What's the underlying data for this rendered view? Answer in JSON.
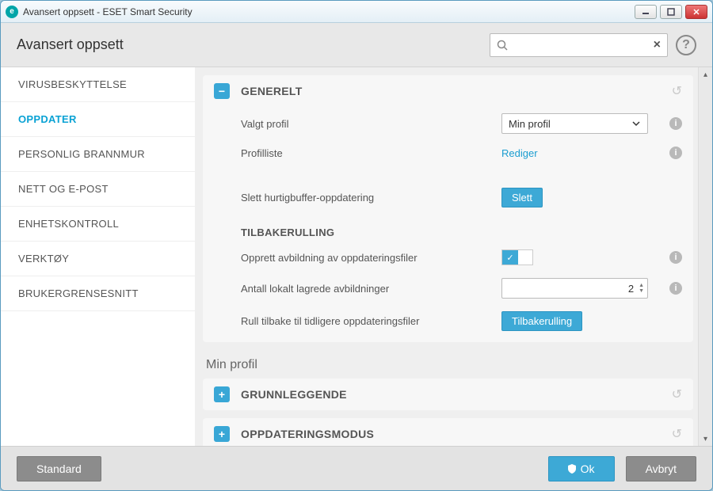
{
  "window": {
    "title": "Avansert oppsett - ESET Smart Security",
    "app_badge": "e"
  },
  "header": {
    "title": "Avansert oppsett",
    "search_placeholder": ""
  },
  "sidebar": {
    "items": [
      {
        "label": "VIRUSBESKYTTELSE"
      },
      {
        "label": "OPPDATER"
      },
      {
        "label": "PERSONLIG BRANNMUR"
      },
      {
        "label": "NETT OG E-POST"
      },
      {
        "label": "ENHETSKONTROLL"
      },
      {
        "label": "VERKTØY"
      },
      {
        "label": "BRUKERGRENSESNITT"
      }
    ],
    "active_index": 1
  },
  "general": {
    "title": "GENERELT",
    "selected_profile_label": "Valgt profil",
    "selected_profile_value": "Min profil",
    "profile_list_label": "Profilliste",
    "profile_list_action": "Rediger",
    "clear_cache_label": "Slett hurtigbuffer-oppdatering",
    "clear_cache_action": "Slett",
    "rollback_header": "TILBAKERULLING",
    "snapshot_toggle_label": "Opprett avbildning av oppdateringsfiler",
    "snapshot_count_label": "Antall lokalt lagrede avbildninger",
    "snapshot_count_value": "2",
    "rollback_label": "Rull tilbake til tidligere oppdateringsfiler",
    "rollback_action": "Tilbakerulling"
  },
  "profile_section_title": "Min profil",
  "collapsed": {
    "basic": "GRUNNLEGGENDE",
    "update_mode": "OPPDATERINGSMODUS"
  },
  "footer": {
    "default": "Standard",
    "ok": "Ok",
    "cancel": "Avbryt"
  }
}
